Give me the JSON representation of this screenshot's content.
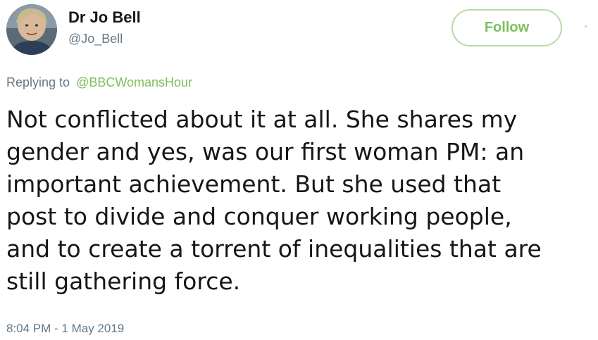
{
  "author": {
    "display_name": "Dr Jo Bell",
    "handle": "@Jo_Bell",
    "avatar_icon": "profile-photo"
  },
  "follow_button": {
    "label": "Follow"
  },
  "reply": {
    "prefix": "Replying to",
    "target": "@BBCWomansHour"
  },
  "tweet": {
    "lines": [
      "Not conflicted about it at all. She shares my",
      "gender and yes, was our first woman PM: an",
      "important achievement. But she used that",
      "post to divide and conquer working people,",
      "and to create a torrent of inequalities that are",
      "still gathering force."
    ],
    "timestamp": "8:04 PM - 1 May 2019"
  },
  "colors": {
    "accent_green": "#7bbf5c",
    "button_border": "#b7dca4",
    "text_primary": "#14171a",
    "text_secondary": "#657786"
  }
}
